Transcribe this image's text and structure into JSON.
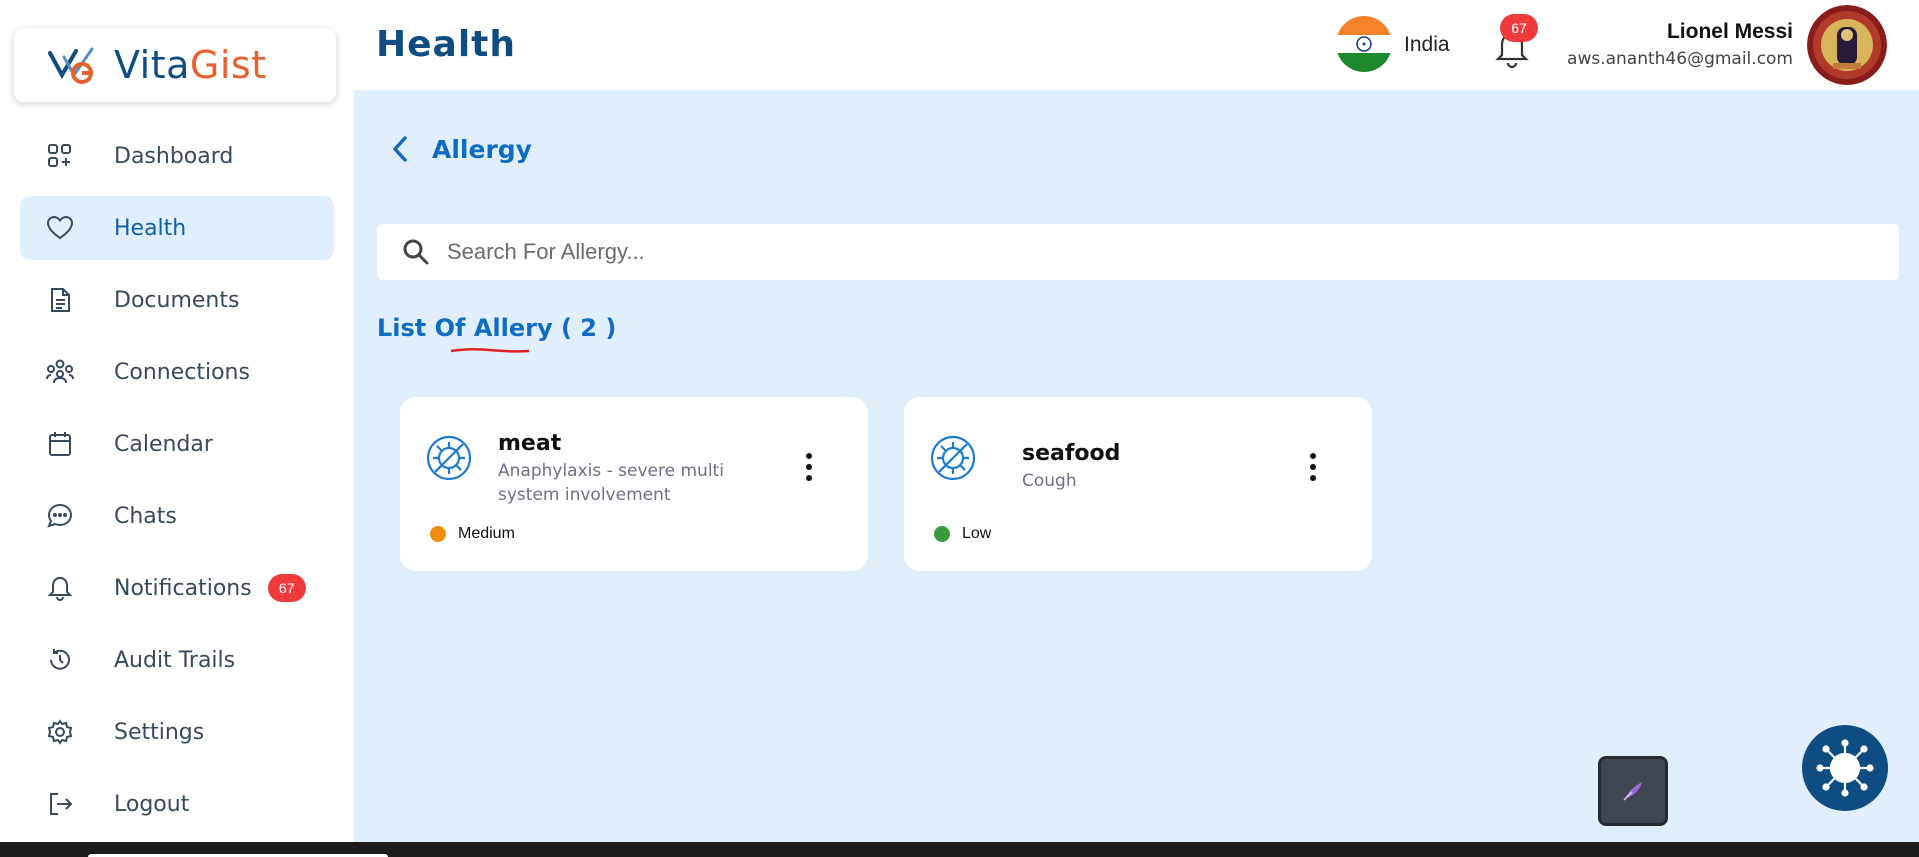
{
  "brand": {
    "name_part1": "Vita",
    "name_part2": "Gist",
    "color_primary": "#0f4c81",
    "color_accent": "#e8612c"
  },
  "sidebar": {
    "items": [
      {
        "label": "Dashboard",
        "icon": "dashboard-icon"
      },
      {
        "label": "Health",
        "icon": "heart-icon",
        "active": true
      },
      {
        "label": "Documents",
        "icon": "document-icon"
      },
      {
        "label": "Connections",
        "icon": "connections-icon"
      },
      {
        "label": "Calendar",
        "icon": "calendar-icon"
      },
      {
        "label": "Chats",
        "icon": "chat-icon"
      },
      {
        "label": "Notifications",
        "icon": "bell-icon",
        "badge": "67"
      },
      {
        "label": "Audit Trails",
        "icon": "history-icon"
      },
      {
        "label": "Settings",
        "icon": "gear-icon"
      },
      {
        "label": "Logout",
        "icon": "logout-icon"
      }
    ]
  },
  "header": {
    "title": "Health",
    "country": "India",
    "notification_count": "67",
    "user_name": "Lionel Messi",
    "user_email": "aws.ananth46@gmail.com"
  },
  "main": {
    "back_label": "Allergy",
    "search_placeholder": "Search For Allergy...",
    "list_title": "List Of Allery ( 2 )",
    "allergies": [
      {
        "name": "meat",
        "description": "Anaphylaxis - severe multi system involvement",
        "severity": "Medium",
        "severity_color": "#f28c0f"
      },
      {
        "name": "seafood",
        "description": "Cough",
        "severity": "Low",
        "severity_color": "#3c9a3c"
      }
    ]
  }
}
